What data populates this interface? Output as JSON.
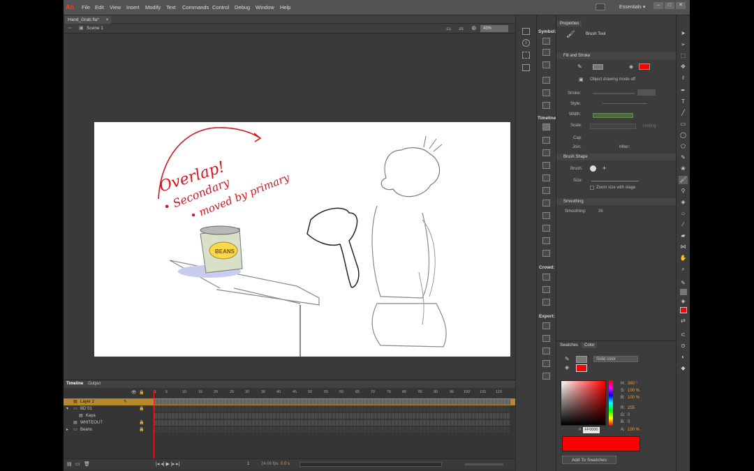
{
  "app": {
    "logo": "An",
    "essentials": "Essentials ▾"
  },
  "menu": [
    "File",
    "Edit",
    "View",
    "Insert",
    "Modify",
    "Text",
    "Commands",
    "Control",
    "Debug",
    "Window",
    "Help"
  ],
  "window_controls": [
    "–",
    "□",
    "✕"
  ],
  "document": {
    "tab": "Hand_Grab.fla*",
    "tab_close": "×",
    "scene": "Scene 1",
    "zoom": "43%"
  },
  "drawing_text": {
    "line1": "Overlap!",
    "line2": "• Secondary",
    "line3": "• moved by primary",
    "can_label": "BEANS"
  },
  "timeline": {
    "tabs": [
      "Timeline",
      "Output"
    ],
    "frame_numbers": [
      "1",
      "5",
      "10",
      "15",
      "20",
      "25",
      "30",
      "35",
      "40",
      "45",
      "50",
      "55",
      "60",
      "65",
      "70",
      "75",
      "80",
      "85",
      "90",
      "95",
      "100",
      "105",
      "110"
    ],
    "layers": [
      {
        "name": "Layer 2",
        "selected": true
      },
      {
        "name": "BD 01",
        "folder": true
      },
      {
        "name": "Kaya",
        "indent": true
      },
      {
        "name": "WHITEOUT"
      },
      {
        "name": "Beans",
        "folder": true
      }
    ],
    "footer": {
      "current_frame": "1",
      "fps": "24.00 fps",
      "time": "0.0 s"
    }
  },
  "symbols": {
    "symbol_label": "Symbol:",
    "timeline_label": "Timeline:",
    "crowd_label": "Crowd:",
    "export_label": "Export:"
  },
  "properties": {
    "tab": "Properties",
    "tool": "Brush Tool",
    "fill_stroke": "Fill and Stroke",
    "object_mode": "Object drawing mode off",
    "stroke_label": "Stroke:",
    "style_label": "Style:",
    "width_label": "Width:",
    "scale_label": "Scale:",
    "hinting": "Hinting",
    "cap_label": "Cap:",
    "join_label": "Join:",
    "miter_label": "Miter:",
    "brush_shape": "Brush Shape",
    "brush_label": "Brush:",
    "size_label": "Size:",
    "zoom_size": "Zoom size with stage",
    "smoothing_section": "Smoothing",
    "smoothing_label": "Smoothing:",
    "smoothing_value": "36",
    "fill_color": "#ff0000"
  },
  "color_panel": {
    "tabs": [
      "Swatches",
      "Color"
    ],
    "type": "Solid color",
    "h_label": "H:",
    "h_value": "360 °",
    "s_label": "S:",
    "s_value": "100 %",
    "b_label": "B:",
    "b_value": "100 %",
    "r_label": "R:",
    "r_value": "255",
    "g_label": "G:",
    "g_value": "0",
    "bl_label": "B:",
    "bl_value": "0",
    "a_label": "A:",
    "a_value": "100 %",
    "hex_label": "#",
    "hex_value": "FF0000",
    "add_swatch": "Add To Swatches",
    "color": "#ff0000"
  },
  "tools": [
    "selection-tool",
    "subselection-tool",
    "free-transform-tool",
    "3d-rotation-tool",
    "lasso-tool",
    "pen-tool",
    "text-tool",
    "line-tool",
    "rectangle-tool",
    "oval-tool",
    "polystar-tool",
    "pencil-tool",
    "brush-tool",
    "deco-tool",
    "bone-tool",
    "paint-bucket-tool",
    "eyedropper-tool",
    "eraser-tool",
    "hand-tool",
    "zoom-tool",
    "stroke-color",
    "fill-color",
    "swap-colors"
  ]
}
